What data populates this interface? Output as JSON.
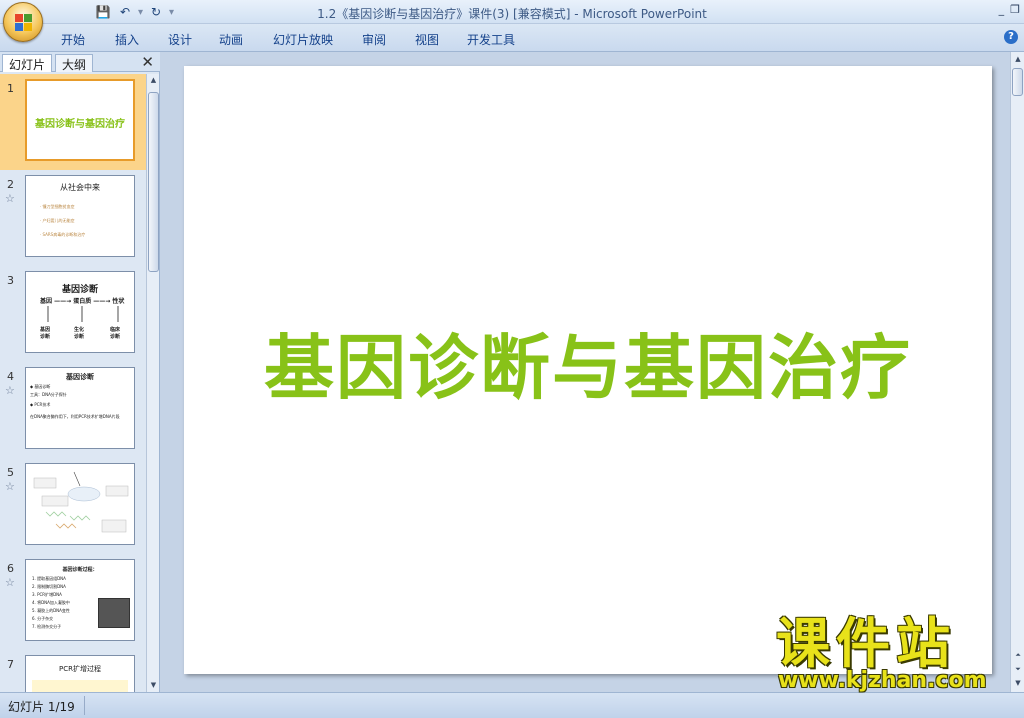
{
  "window": {
    "title": "1.2《基因诊断与基因治疗》课件(3) [兼容模式] - Microsoft PowerPoint",
    "controls": [
      "_",
      "❐"
    ]
  },
  "quick_access": [
    {
      "name": "save-icon",
      "glyph": "💾"
    },
    {
      "name": "undo-icon",
      "glyph": "↶"
    },
    {
      "name": "redo-icon",
      "glyph": "↻"
    }
  ],
  "ribbon": {
    "tabs": [
      "开始",
      "插入",
      "设计",
      "动画",
      "幻灯片放映",
      "审阅",
      "视图",
      "开发工具"
    ]
  },
  "pane": {
    "tabs": [
      "幻灯片",
      "大纲"
    ],
    "close": "✕"
  },
  "thumbnails": [
    {
      "num": "1",
      "title": "基因诊断与基因治疗",
      "selected": true
    },
    {
      "num": "2",
      "title": "从社会中来",
      "lines": [
        "· 镰刀型细胞贫血症",
        "· 产妇婴儿的无能症",
        "· SARS病毒的诊断和治疗"
      ]
    },
    {
      "num": "3",
      "title": "基因诊断",
      "row1": "基因 ——→ 蛋白质 ——→ 性状",
      "labels": [
        "基因\n诊断",
        "生化\n诊断",
        "临床\n诊断"
      ]
    },
    {
      "num": "4",
      "title": "基因诊断",
      "lines": [
        "◆ 基因诊断",
        "工具：DNA分子探针",
        "◆ PCR技术",
        "在DNA聚合酶作用下，利用PCR技术扩增DNA片段"
      ]
    },
    {
      "num": "5",
      "title": ""
    },
    {
      "num": "6",
      "title": "基因诊断过程：",
      "lines": [
        "1. 提取基因组DNA",
        "2. 限制酶切割DNA",
        "3. PCR扩增DNA",
        "4. 将DNA加入凝胶中",
        "5. 凝胶上的DNA变性",
        "6. 分子杂交",
        "7. 检测杂交分子"
      ]
    },
    {
      "num": "7",
      "title": "PCR扩增过程"
    }
  ],
  "slide": {
    "title": "基因诊断与基因治疗"
  },
  "status": {
    "slide_counter": "幻灯片 1/19"
  },
  "watermark": {
    "cn": "课件站",
    "url": "www.kjzhan.com"
  },
  "colors": {
    "slide_title": "#88c218",
    "selected_thumb": "#fbd48a"
  }
}
